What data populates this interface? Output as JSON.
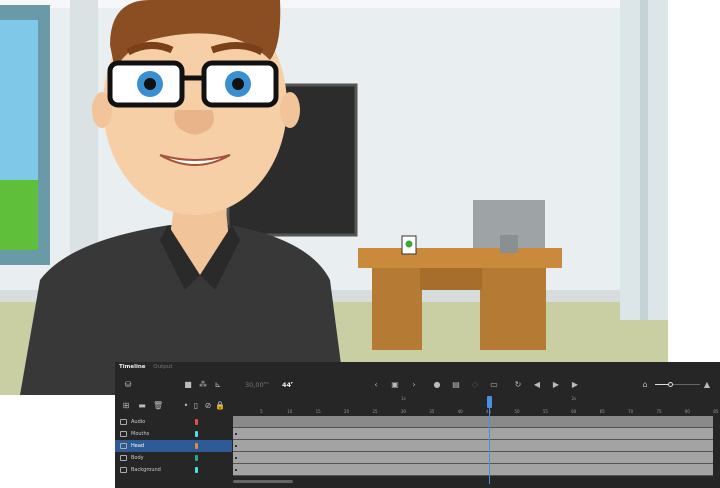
{
  "timeline": {
    "tabs": [
      {
        "label": "Timeline",
        "active": true
      },
      {
        "label": "Output",
        "active": false
      }
    ],
    "fps": "30,00",
    "fps_unit": "FPS",
    "current_frame": "44",
    "current_frame_unit": "F",
    "ruler_ticks": [
      "5",
      "10",
      "15",
      "20",
      "25",
      "30",
      "35",
      "40",
      "45",
      "50",
      "55",
      "60",
      "65",
      "70",
      "75",
      "80",
      "85"
    ],
    "second_markers": [
      "1s",
      "2s"
    ],
    "playhead_frame": 45,
    "zoom_level": 0.35,
    "layers": [
      {
        "name": "Audio",
        "color": "#e0504a",
        "selected": false
      },
      {
        "name": "Mouths",
        "color": "#4fe0e0",
        "selected": false
      },
      {
        "name": "Head",
        "color": "#e08a3c",
        "selected": true
      },
      {
        "name": "Body",
        "color": "#2aa88a",
        "selected": false
      },
      {
        "name": "Background",
        "color": "#4fe0e0",
        "selected": false
      }
    ],
    "accent": "#4a8fe0"
  },
  "scene": {
    "mug_logo": "mug-logo"
  }
}
